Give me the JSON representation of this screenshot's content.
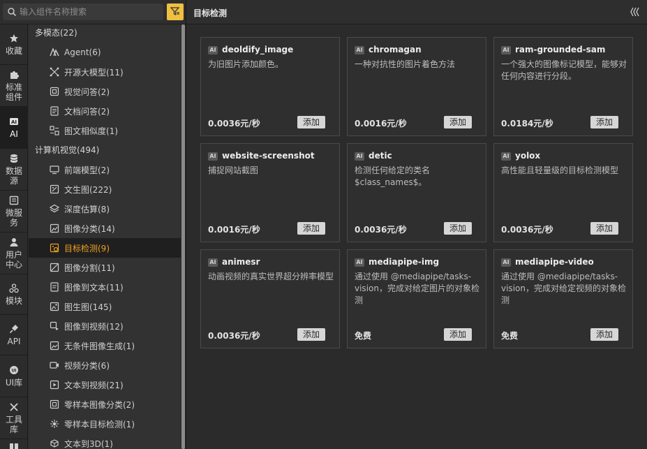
{
  "search": {
    "placeholder": "输入组件名称搜索"
  },
  "rail": [
    {
      "label": "收藏",
      "icon": "star-icon"
    },
    {
      "label": "标准组件",
      "icon": "puzzle-icon"
    },
    {
      "label": "AI",
      "icon": "ai-icon",
      "active": true
    },
    {
      "label": "数据源",
      "icon": "database-icon"
    },
    {
      "label": "微服务",
      "icon": "service-icon"
    },
    {
      "label": "用户中心",
      "icon": "user-icon"
    },
    {
      "label": "模块",
      "icon": "modules-icon"
    },
    {
      "label": "API",
      "icon": "plug-icon"
    },
    {
      "label": "UI库",
      "icon": "ui-library-icon"
    },
    {
      "label": "工具库",
      "icon": "tools-icon"
    }
  ],
  "components": {
    "multimodal": {
      "label": "多模态(22)",
      "items": [
        {
          "label": "Agent(6)",
          "icon": "agent-icon"
        },
        {
          "label": "开源大模型(11)",
          "icon": "open-model-icon"
        },
        {
          "label": "视觉问答(2)",
          "icon": "visual-qa-icon"
        },
        {
          "label": "文档问答(2)",
          "icon": "document-qa-icon"
        },
        {
          "label": "图文相似度(1)",
          "icon": "similarity-icon"
        }
      ]
    },
    "vision": {
      "label": "计算机视觉(494)",
      "items": [
        {
          "label": "前端模型(2)",
          "icon": "monitor-icon"
        },
        {
          "label": "文生图(222)",
          "icon": "text-to-image-icon"
        },
        {
          "label": "深度估算(8)",
          "icon": "layers-icon"
        },
        {
          "label": "图像分类(14)",
          "icon": "image-classify-icon"
        },
        {
          "label": "目标检测(9)",
          "icon": "object-detection-icon",
          "active": true
        },
        {
          "label": "图像分割(11)",
          "icon": "image-segment-icon"
        },
        {
          "label": "图像到文本(11)",
          "icon": "image-to-text-icon"
        },
        {
          "label": "图生图(145)",
          "icon": "image-to-image-icon"
        },
        {
          "label": "图像到视频(12)",
          "icon": "image-to-video-icon"
        },
        {
          "label": "无条件图像生成(1)",
          "icon": "image-generate-icon"
        },
        {
          "label": "视频分类(6)",
          "icon": "video-classify-icon"
        },
        {
          "label": "文本到视频(21)",
          "icon": "text-to-video-icon"
        },
        {
          "label": "零样本图像分类(2)",
          "icon": "zero-shot-classify-icon"
        },
        {
          "label": "零样本目标检测(1)",
          "icon": "zero-shot-detect-icon"
        },
        {
          "label": "文本到3D(1)",
          "icon": "text-to-3d-icon"
        }
      ]
    }
  },
  "main": {
    "title": "目标检测",
    "add_label": "添加",
    "ai_badge": "AI",
    "cards": [
      {
        "title": "deoldify_image",
        "desc": "为旧图片添加颜色。",
        "price": "0.0036元/秒"
      },
      {
        "title": "chromagan",
        "desc": "一种对抗性的图片着色方法",
        "price": "0.0016元/秒"
      },
      {
        "title": "ram-grounded-sam",
        "desc": "一个强大的图像标记模型，能够对任何内容进行分段。",
        "price": "0.0184元/秒"
      },
      {
        "title": "website-screenshot",
        "desc": "捕捉网站截图",
        "price": "0.0016元/秒"
      },
      {
        "title": "detic",
        "desc": "检测任何给定的类名$class_names$。",
        "price": "0.0036元/秒"
      },
      {
        "title": "yolox",
        "desc": "高性能且轻量级的目标检测模型",
        "price": "0.0036元/秒"
      },
      {
        "title": "animesr",
        "desc": "动画视频的真实世界超分辨率模型",
        "price": "0.0036元/秒"
      },
      {
        "title": "mediapipe-img",
        "desc": "通过使用 @mediapipe/tasks-vision，完成对给定图片的对象检测",
        "price": "免费"
      },
      {
        "title": "mediapipe-video",
        "desc": "通过使用 @mediapipe/tasks-vision，完成对给定视频的对象检测",
        "price": "免费"
      }
    ]
  }
}
